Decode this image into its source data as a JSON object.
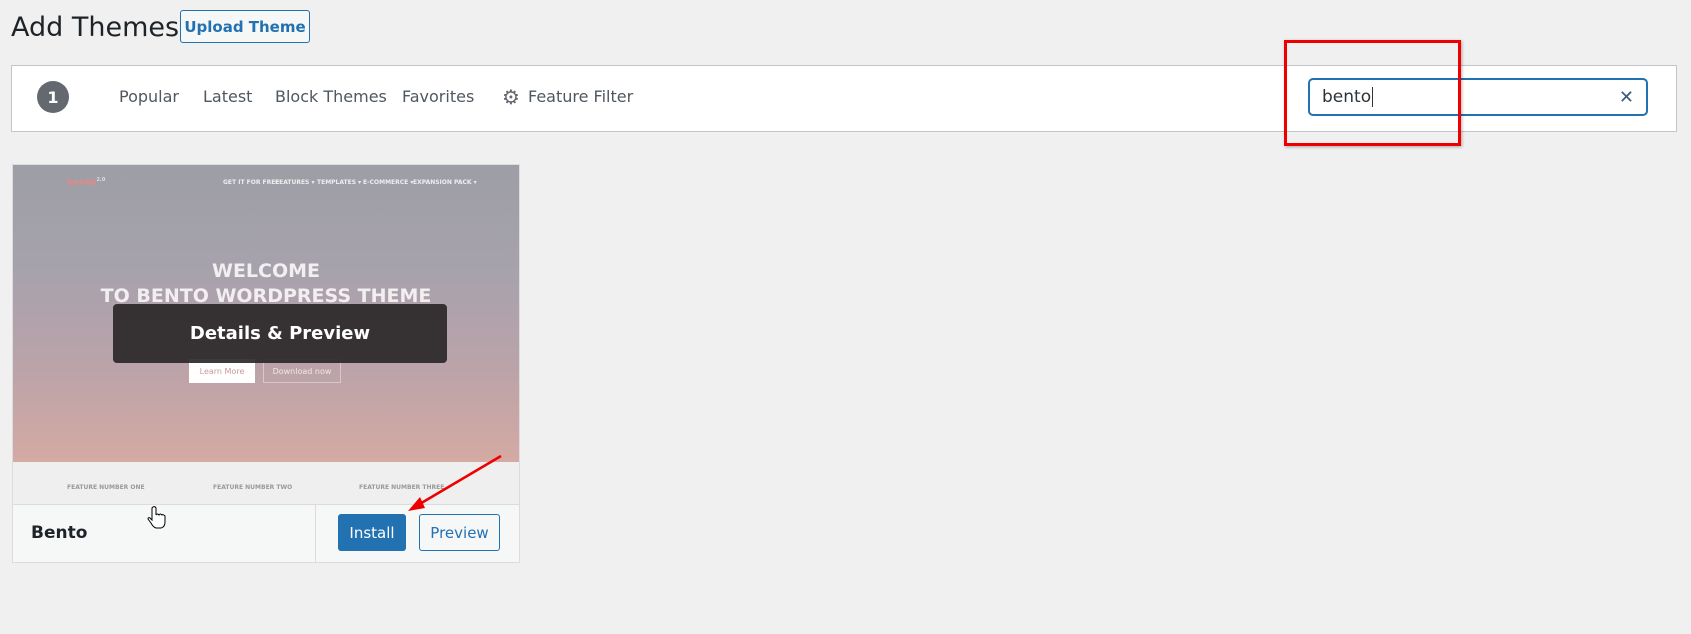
{
  "header": {
    "title": "Add Themes",
    "upload_label": "Upload Theme"
  },
  "filter_bar": {
    "count": "1",
    "tabs": [
      {
        "label": "Popular"
      },
      {
        "label": "Latest"
      },
      {
        "label": "Block Themes"
      },
      {
        "label": "Favorites"
      }
    ],
    "feature_filter_label": "Feature Filter",
    "feature_filter_icon": "gear-icon"
  },
  "search": {
    "value": "bento",
    "clear_icon": "close-icon"
  },
  "theme": {
    "name": "Bento",
    "overlay_label": "Details & Preview",
    "install_label": "Install",
    "preview_label": "Preview",
    "screenshot": {
      "logo": "bentō",
      "logo_version": "2.0",
      "nav": [
        "GET IT FOR FREE",
        "FEATURES ▾",
        "TEMPLATES ▾",
        "E-COMMERCE ▾",
        "EXPANSION PACK ▾"
      ],
      "heading_1": "WELCOME",
      "heading_2": "TO BENTO WORDPRESS THEME",
      "learn_more": "Learn More",
      "download_now": "Download now",
      "features": [
        "FEATURE NUMBER ONE",
        "FEATURE NUMBER TWO",
        "FEATURE NUMBER THREE"
      ]
    }
  },
  "colors": {
    "accent": "#2271b1",
    "annotation": "#e00000"
  }
}
